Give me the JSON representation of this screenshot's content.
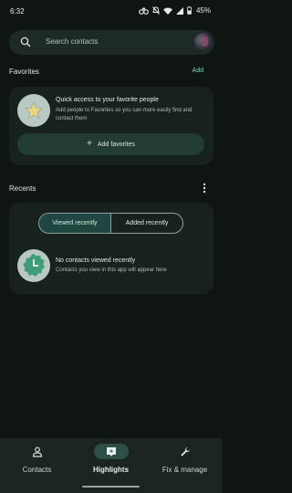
{
  "status_bar": {
    "time": "6:32",
    "battery_percent": "45%",
    "icons": [
      "link-icon",
      "mute-icon",
      "wifi-icon",
      "signal-icon",
      "battery-icon"
    ]
  },
  "search": {
    "placeholder": "Search contacts"
  },
  "favorites": {
    "title": "Favorites",
    "add_label": "Add",
    "card_heading": "Quick access to your favorite people",
    "card_body": "Add people to Favorites so you can more easily find and contact them",
    "button_label": "Add favorites"
  },
  "recents": {
    "title": "Recents",
    "tabs": [
      {
        "label": "Viewed recently",
        "selected": true
      },
      {
        "label": "Added recently",
        "selected": false
      }
    ],
    "empty_title": "No contacts viewed recently",
    "empty_subtitle": "Contacts you view in this app will appear here"
  },
  "bottom_nav": {
    "items": [
      {
        "label": "Contacts",
        "icon": "person-icon",
        "active": false
      },
      {
        "label": "Highlights",
        "icon": "highlights-icon",
        "active": true
      },
      {
        "label": "Fix & manage",
        "icon": "wrench-icon",
        "active": false
      }
    ]
  },
  "colors": {
    "background": "#0f1513",
    "card": "#17221f",
    "accent": "#7fd8b8",
    "active_nav": "#2e4f47"
  }
}
